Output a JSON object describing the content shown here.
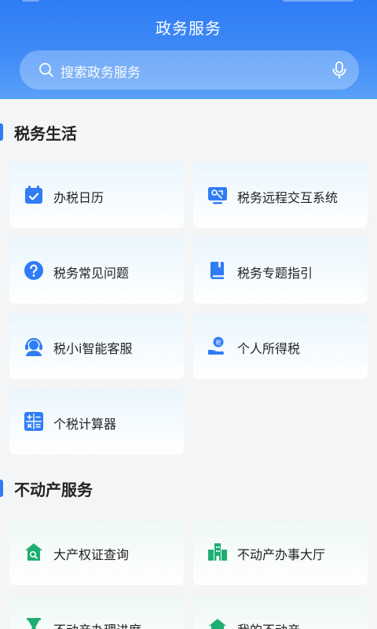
{
  "header": {
    "title": "政务服务",
    "search_placeholder": "搜索政务服务"
  },
  "sections": [
    {
      "title": "税务生活",
      "items": [
        {
          "label": "办税日历",
          "icon": "calendar-icon"
        },
        {
          "label": "税务远程交互系统",
          "icon": "remote-monitor-icon"
        },
        {
          "label": "税务常见问题",
          "icon": "question-icon"
        },
        {
          "label": "税务专题指引",
          "icon": "book-icon"
        },
        {
          "label": "税小i智能客服",
          "icon": "headset-agent-icon"
        },
        {
          "label": "个人所得税",
          "icon": "hand-coin-icon"
        },
        {
          "label": "个税计算器",
          "icon": "calculator-icon"
        }
      ]
    },
    {
      "title": "不动产服务",
      "items": [
        {
          "label": "大产权证查询",
          "icon": "house-search-icon"
        },
        {
          "label": "不动产办事大厅",
          "icon": "office-building-icon"
        },
        {
          "label": "不动产办理进度",
          "icon": "hourglass-icon"
        },
        {
          "label": "我的不动产",
          "icon": "my-house-icon"
        }
      ]
    }
  ],
  "colors": {
    "accent_blue": "#2f7cf6",
    "accent_green": "#1fae72",
    "header_top": "#2f7cf6",
    "header_bottom": "#5aa1f8"
  }
}
